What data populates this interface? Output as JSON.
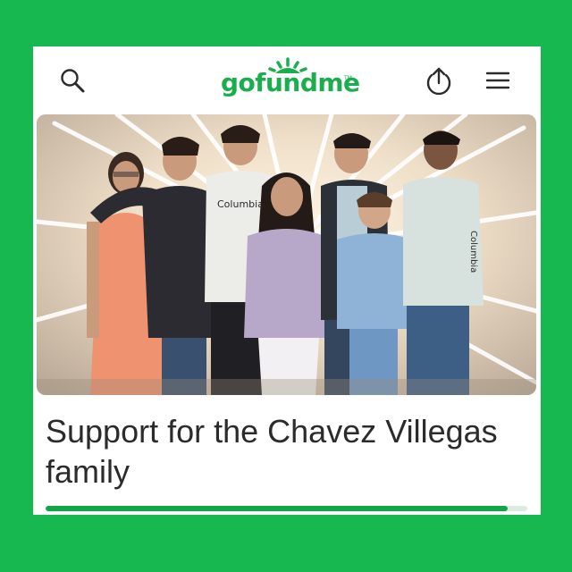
{
  "header": {
    "logo_text": "gofundme",
    "logo_tm": "TM",
    "icons": {
      "search": "search-icon",
      "share": "share-icon",
      "menu": "menu-icon"
    }
  },
  "hero": {
    "shirt_text": "Columbia",
    "sleeve_text": "Columbia"
  },
  "campaign": {
    "title": "Support for the Chavez Villegas family",
    "progress_fraction": 0.96
  },
  "colors": {
    "background": "#16b84f",
    "brand": "#1aae4e",
    "progress": "#11a54a",
    "title": "#2b2b2b"
  }
}
